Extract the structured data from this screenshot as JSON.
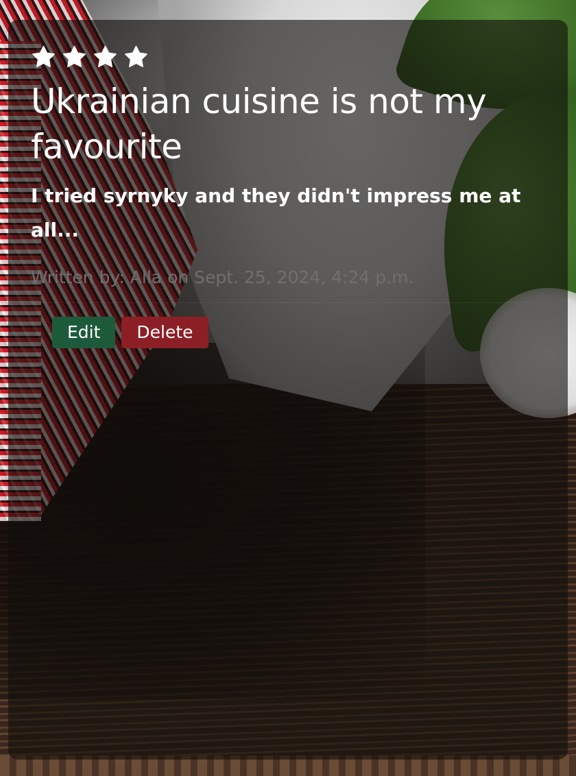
{
  "review": {
    "rating": 4,
    "star_color": "#ffffff",
    "title": "Ukrainian cuisine is not my favourite",
    "body": "I tried syrnyky and they didn't impress me at all...",
    "meta": "Written by: Alla on Sept. 25, 2024, 4:24 p.m."
  },
  "actions": {
    "edit_label": "Edit",
    "delete_label": "Delete",
    "edit_color": "#1d5a3a",
    "delete_color": "#8c1f25"
  }
}
